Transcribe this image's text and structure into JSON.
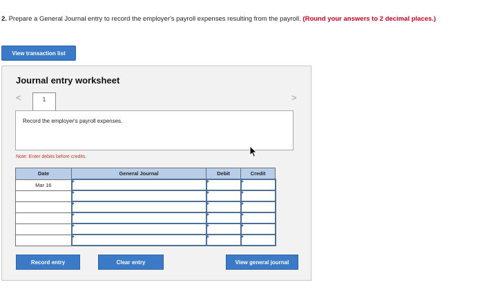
{
  "question": {
    "number": "2.",
    "text": "Prepare a General Journal entry to record the employer's payroll expenses resulting from the payroll.",
    "hint": "(Round your answers to 2 decimal places.)"
  },
  "buttons": {
    "view_transaction_list": "View transaction list",
    "record_entry": "Record entry",
    "clear_entry": "Clear entry",
    "view_general_journal": "View general journal"
  },
  "worksheet": {
    "title": "Journal entry worksheet",
    "nav_prev": "<",
    "nav_next": ">",
    "tab_number": "1",
    "description": "Record the employer's payroll expenses.",
    "note": "Note: Enter debits before credits."
  },
  "table": {
    "headers": [
      "Date",
      "General Journal",
      "Debit",
      "Credit"
    ],
    "rows": [
      {
        "date": "Mar 16",
        "account": "",
        "debit": "",
        "credit": ""
      },
      {
        "date": "",
        "account": "",
        "debit": "",
        "credit": ""
      },
      {
        "date": "",
        "account": "",
        "debit": "",
        "credit": ""
      },
      {
        "date": "",
        "account": "",
        "debit": "",
        "credit": ""
      },
      {
        "date": "",
        "account": "",
        "debit": "",
        "credit": ""
      },
      {
        "date": "",
        "account": "",
        "debit": "",
        "credit": ""
      }
    ]
  }
}
